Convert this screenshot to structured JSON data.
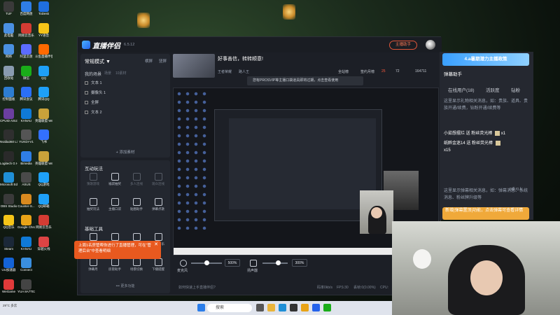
{
  "desktop": {
    "icons": [
      {
        "label": "TUF",
        "color": "#3a3a3a"
      },
      {
        "label": "此电脑",
        "color": "#4a90e2"
      },
      {
        "label": "网络",
        "color": "#4a90e2"
      },
      {
        "label": "回收站",
        "color": "#8a9bb0"
      },
      {
        "label": "控制面板",
        "color": "#2d7dd2"
      },
      {
        "label": "CPUID ASUS CPU-Z",
        "color": "#6b3fa0"
      },
      {
        "label": "Nvidia360 Link Co...",
        "color": "#2f2f2f"
      },
      {
        "label": "Logitech G HUB",
        "color": "#2a2a2a"
      },
      {
        "label": "Microsoft Edge",
        "color": "#1f8fd6"
      },
      {
        "label": "OBS Studio",
        "color": "#3a3a3a"
      },
      {
        "label": "QQ音乐",
        "color": "#f5c518"
      },
      {
        "label": "Steam",
        "color": "#1b2838"
      },
      {
        "label": "UU加速器",
        "color": "#1463d6"
      },
      {
        "label": "WeGame",
        "color": "#e03a3a"
      },
      {
        "label": "百度网盘",
        "color": "#2f7ee6"
      },
      {
        "label": "网易云音乐",
        "color": "#d43c33"
      },
      {
        "label": "阿里云盘",
        "color": "#5b6cff"
      },
      {
        "label": "微信",
        "color": "#1aad19"
      },
      {
        "label": "腾讯会议",
        "color": "#2b6ff6"
      },
      {
        "label": "KANAU",
        "color": "#0f7ad8"
      },
      {
        "label": "YUKDI-V1",
        "color": "#555555"
      },
      {
        "label": "Bimedia",
        "color": "#2f7ee6"
      },
      {
        "label": "ASUS",
        "color": "#4a4a4a"
      },
      {
        "label": "Counter-S...",
        "color": "#d98a1f"
      },
      {
        "label": "Google Chrome",
        "color": "#e8a317"
      },
      {
        "label": "KANAU",
        "color": "#0f7ad8"
      },
      {
        "label": "Connect",
        "color": "#3a8fe0"
      },
      {
        "label": "YUA 8A7TE3...",
        "color": "#444444"
      },
      {
        "label": "ToDesk",
        "color": "#1f6fe0"
      },
      {
        "label": "YY语音",
        "color": "#f5c518"
      },
      {
        "label": "斗鱼直播伴侣",
        "color": "#ff6a00"
      },
      {
        "label": "QQ",
        "color": "#1ea0f7"
      },
      {
        "label": "腾讯QQ",
        "color": "#1ea0f7"
      },
      {
        "label": "英雄联盟 WeGame版",
        "color": "#c9a23a"
      },
      {
        "label": "飞书",
        "color": "#3370ff"
      },
      {
        "label": "英雄联盟 WeGame版",
        "color": "#c9a23a"
      },
      {
        "label": "QQ游戏",
        "color": "#1ea0f7"
      },
      {
        "label": "QQ邮箱",
        "color": "#1ea0f7"
      },
      {
        "label": "网易云音乐",
        "color": "#d43c33"
      },
      {
        "label": "穿越火线",
        "color": "#d44"
      }
    ]
  },
  "app": {
    "name": "直播伴侣",
    "version": "6.5.12",
    "go_live": "主播助手"
  },
  "left_panel": {
    "mode": "常规模式 ▼",
    "mode_links": [
      "横屏",
      "竖屏"
    ],
    "scenes_title": "我的场景",
    "scenes_sub": [
      "场景",
      "10素材"
    ],
    "scenes": [
      "文本 1",
      "摄像头 1",
      "全屏",
      "文本 2"
    ],
    "add_source": "+ 添加素材",
    "interact_title": "互动玩法",
    "interact_tools": [
      {
        "label": "猜歌游戏",
        "dim": true
      },
      {
        "label": "福袋抽奖",
        "dim": false
      },
      {
        "label": "多人连线",
        "dim": true
      },
      {
        "label": "观众连线",
        "dim": true
      },
      {
        "label": "抽奖玩法",
        "dim": false
      },
      {
        "label": "主播口袋",
        "dim": false
      },
      {
        "label": "贴图助手",
        "dim": false
      },
      {
        "label": "弹幕点歌",
        "dim": false
      }
    ],
    "basic_title": "基础工具",
    "basic_tools": [
      {
        "label": "任务"
      },
      {
        "label": "AR"
      },
      {
        "label": "直播间"
      },
      {
        "label": "直播音乐"
      },
      {
        "label": "弹幕月"
      },
      {
        "label": "房管助手"
      },
      {
        "label": "场景切换"
      },
      {
        "label": "下播提醒"
      }
    ],
    "more": "••• 更多功能",
    "toast": "上周1名房管帮你进行了直播管理，可在“管理后台”中查看明细"
  },
  "center": {
    "room_title": "好事善信，转转顺意!",
    "room_meta": [
      "王者荣耀",
      "路人王"
    ],
    "stats": {
      "all": "全站榜",
      "gift_label": "签约月榜",
      "gift_value": "25",
      "likes": "72",
      "views": "164711"
    },
    "notice": "您有PROSVIP等主播口袋道具即将过期，点击查看使用",
    "mic": {
      "label": "麦克风",
      "pct": "500%",
      "level": 0.5
    },
    "speaker": {
      "label": "扬声器",
      "pct": "300%",
      "level": 0.6
    },
    "right_buttons": [
      "美颜",
      "录制",
      "设置"
    ],
    "status": {
      "hint": "如何快速上手直播伴侣?",
      "bitrate": "码率0kb/s",
      "fps": "FPS:30",
      "drop": "丢帧:0(0.00%)",
      "cpu": "CPU:"
    },
    "preview_taskbar_search": "搜索"
  },
  "right_panel": {
    "banner": "4.a暑期潜力主播政策",
    "title": "弹幕助手",
    "tabs": [
      "在线用户(18)",
      "活跃度",
      "钻粉"
    ],
    "hint1": "这里显示礼物相关消息，如：贵族、道具、贵族开通/续费，钻粉开通/续费等",
    "gifts": [
      {
        "text": "小茹想摆烂 送 粉丝荧光棒",
        "count": "x1"
      },
      {
        "text": "纸醉金迷14 送 粉丝荧光棒",
        "count": "x15"
      }
    ],
    "hint2": "这里显示弹幕相关消息，如：弹幕消息、系统消息、粉丝牌升级等",
    "online": "0条/0人",
    "new_feature": "新增|弹幕置顶|功能，点击弹幕可查看详情"
  },
  "taskbar": {
    "weather": "29°C 多云",
    "search": "搜索"
  }
}
